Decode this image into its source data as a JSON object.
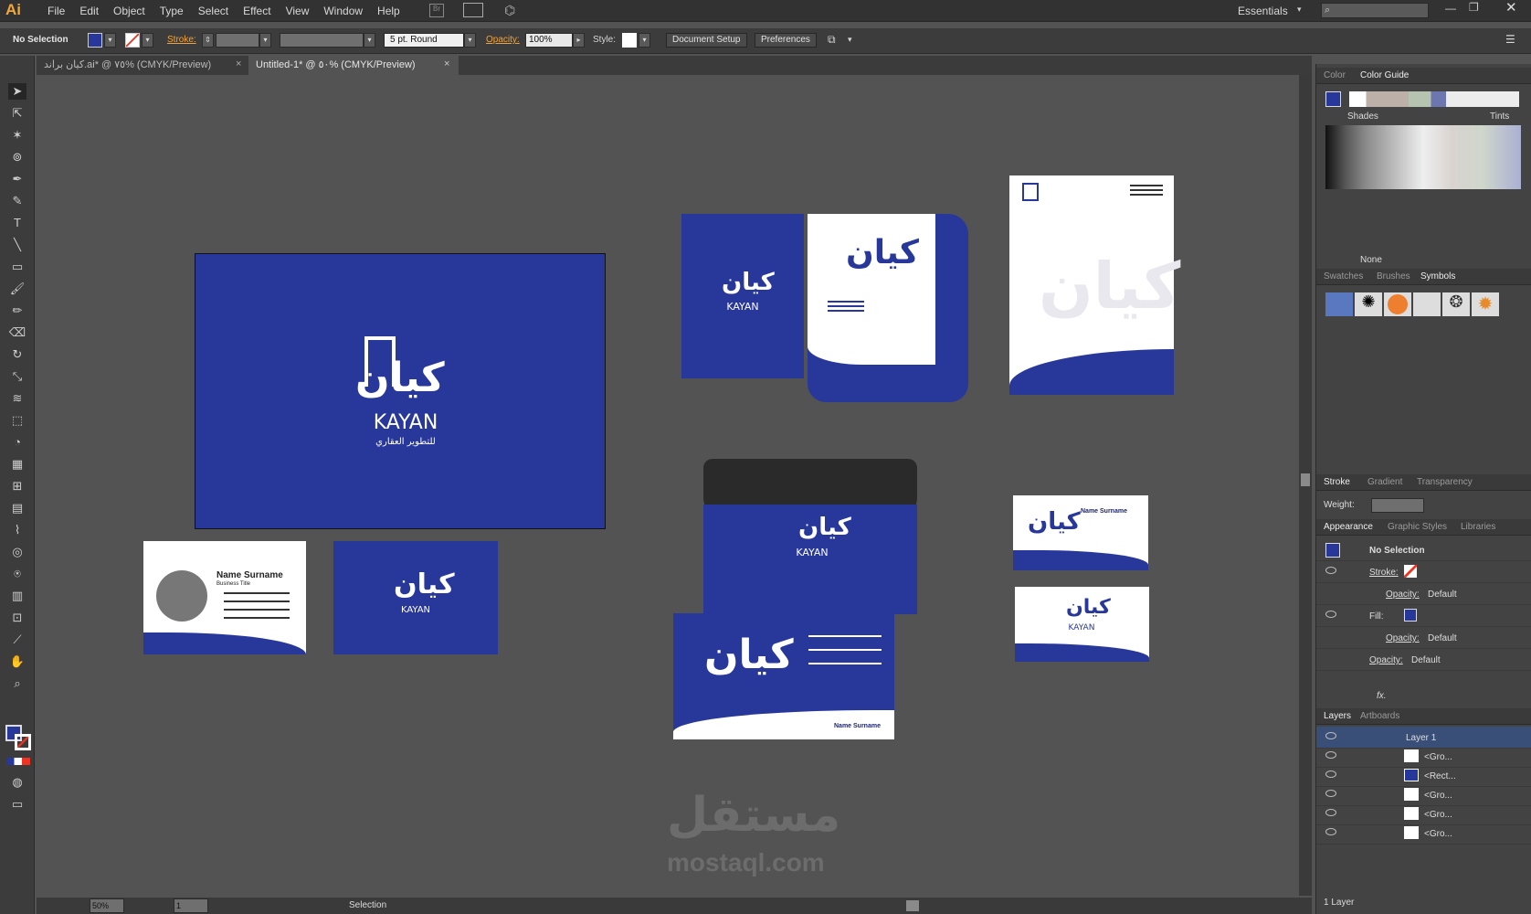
{
  "app": {
    "logo": "Ai",
    "workspace": "Essentials"
  },
  "menu": [
    "File",
    "Edit",
    "Object",
    "Type",
    "Select",
    "Effect",
    "View",
    "Window",
    "Help"
  ],
  "control": {
    "selection": "No Selection",
    "stroke_label": "Stroke:",
    "brush": "5 pt. Round",
    "opacity_label": "Opacity:",
    "opacity_value": "100%",
    "style_label": "Style:",
    "document_setup": "Document Setup",
    "preferences": "Preferences"
  },
  "tabs": [
    {
      "label": "كيان براند.ai* @ ٧٥% (CMYK/Preview)",
      "close": "×"
    },
    {
      "label": "Untitled-1* @ ٥٠% (CMYK/Preview)",
      "close": "×"
    }
  ],
  "status": {
    "zoom": "50%",
    "page": "1",
    "tool": "Selection"
  },
  "color_panel": {
    "tabs": [
      "Color",
      "Color Guide"
    ],
    "shades": "Shades",
    "tints": "Tints",
    "none": "None"
  },
  "symbols_panel": {
    "tabs": [
      "Swatches",
      "Brushes",
      "Symbols"
    ]
  },
  "stroke_panel": {
    "tabs": [
      "Stroke",
      "Gradient",
      "Transparency"
    ],
    "weight_label": "Weight:"
  },
  "appearance_panel": {
    "tabs": [
      "Appearance",
      "Graphic Styles",
      "Libraries"
    ],
    "title": "No Selection",
    "stroke": "Stroke:",
    "opacity": "Opacity:",
    "opacity_value": "Default",
    "fill": "Fill:",
    "fx": "fx."
  },
  "layers_panel": {
    "tabs": [
      "Layers",
      "Artboards"
    ],
    "layers": [
      "Layer 1",
      "<Gro...",
      "<Rect...",
      "<Gro...",
      "<Gro...",
      "<Gro..."
    ],
    "count": "1 Layer"
  },
  "artwork": {
    "brand_en": "KAYAN",
    "brand_ar": "كيان",
    "tagline_ar": "للتطوير العقاري",
    "name": "Name Surname",
    "title": "Business Title"
  },
  "watermark": {
    "ar": "مستقل",
    "en": "mostaql.com"
  },
  "colors": {
    "brand_blue": "#28389a",
    "accent_orange": "#f1a33b"
  }
}
